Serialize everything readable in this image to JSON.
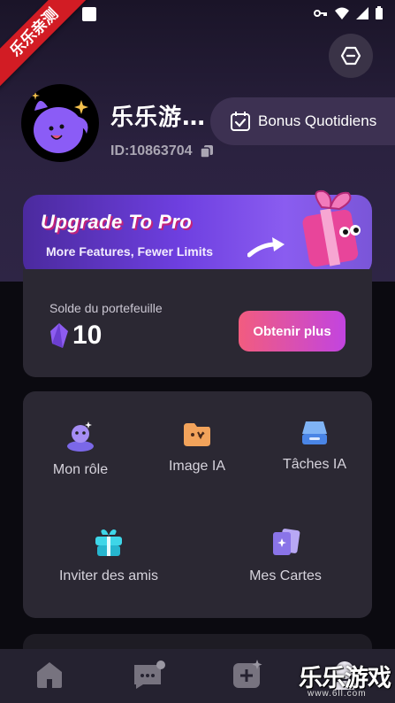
{
  "ribbon": {
    "text": "乐乐亲测"
  },
  "profile": {
    "username": "乐乐游…",
    "id_text": "ID:10863704"
  },
  "bonus": {
    "label": "Bonus Quotidiens"
  },
  "upgrade": {
    "title": "Upgrade To Pro",
    "subtitle": "More Features, Fewer Limits"
  },
  "wallet": {
    "label": "Solde du portefeuille",
    "value": "10",
    "button": "Obtenir plus"
  },
  "menu": {
    "items": [
      {
        "label": "Mon rôle",
        "icon": "character-icon"
      },
      {
        "label": "Image IA",
        "icon": "image-ai-icon"
      },
      {
        "label": "Tâches IA",
        "icon": "tasks-icon"
      },
      {
        "label": "Inviter des amis",
        "icon": "gift-icon"
      },
      {
        "label": "Mes Cartes",
        "icon": "cards-icon"
      }
    ]
  },
  "bottom_nav": {
    "items": [
      {
        "name": "home-icon"
      },
      {
        "name": "chat-icon"
      },
      {
        "name": "create-icon"
      },
      {
        "name": "profile-icon"
      }
    ]
  },
  "watermark": {
    "text": "乐乐游戏",
    "sub": "www.6ll.com"
  },
  "colors": {
    "accent_purple": "#6e3fe0",
    "button_pink": "#f25c7f",
    "card_bg": "#2b2833"
  }
}
